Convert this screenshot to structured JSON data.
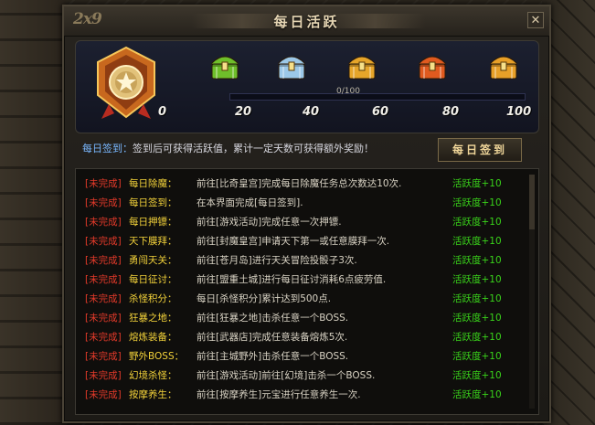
{
  "window": {
    "title": "每日活跃",
    "close_label": "✕",
    "logo_text": "2x9"
  },
  "progress": {
    "text": "0/100",
    "current": 0,
    "max": 100,
    "milestones": [
      "0",
      "20",
      "40",
      "60",
      "80",
      "100"
    ],
    "chests": [
      {
        "icon": "green-chest-icon",
        "color": "#6fbf2a"
      },
      {
        "icon": "blue-chest-icon",
        "color": "#9cc8e8"
      },
      {
        "icon": "gold-chest-icon",
        "color": "#e6a52a"
      },
      {
        "icon": "red-chest-icon",
        "color": "#e05a1f"
      },
      {
        "icon": "orange-chest-icon",
        "color": "#e8a028"
      }
    ]
  },
  "signin": {
    "label": "每日签到：",
    "desc": "签到后可获得活跃值，累计一定天数可获得额外奖励！",
    "button": "每日签到"
  },
  "tasks": [
    {
      "status": "[未完成]",
      "name": "每日除魔：",
      "desc": "前往[比奇皇宫]完成每日除魔任务总次数达10次.",
      "reward": "活跃度+10"
    },
    {
      "status": "[未完成]",
      "name": "每日签到：",
      "desc": "在本界面完成[每日签到].",
      "reward": "活跃度+10"
    },
    {
      "status": "[未完成]",
      "name": "每日押镖：",
      "desc": "前往[游戏活动]完成任意一次押镖.",
      "reward": "活跃度+10"
    },
    {
      "status": "[未完成]",
      "name": "天下膜拜：",
      "desc": "前往[封魔皇宫]申请天下第一或任意膜拜一次.",
      "reward": "活跃度+10"
    },
    {
      "status": "[未完成]",
      "name": "勇闯天关：",
      "desc": "前往[苍月岛]进行天关冒险投骰子3次.",
      "reward": "活跃度+10"
    },
    {
      "status": "[未完成]",
      "name": "每日征讨：",
      "desc": "前往[盟重土城]进行每日征讨消耗6点疲劳值.",
      "reward": "活跃度+10"
    },
    {
      "status": "[未完成]",
      "name": "杀怪积分：",
      "desc": "每日[杀怪积分]累计达到500点.",
      "reward": "活跃度+10"
    },
    {
      "status": "[未完成]",
      "name": "狂暴之地：",
      "desc": "前往[狂暴之地]击杀任意一个BOSS.",
      "reward": "活跃度+10"
    },
    {
      "status": "[未完成]",
      "name": "熔炼装备：",
      "desc": "前往[武器店]完成任意装备熔炼5次.",
      "reward": "活跃度+10"
    },
    {
      "status": "[未完成]",
      "name": "野外BOSS：",
      "desc": "前往[主城野外]击杀任意一个BOSS.",
      "reward": "活跃度+10"
    },
    {
      "status": "[未完成]",
      "name": "幻境杀怪：",
      "desc": "前往[游戏活动]前往[幻境]击杀一个BOSS.",
      "reward": "活跃度+10"
    },
    {
      "status": "[未完成]",
      "name": "按摩养生：",
      "desc": "前往[按摩养生]元宝进行任意养生一次.",
      "reward": "活跃度+10"
    }
  ]
}
